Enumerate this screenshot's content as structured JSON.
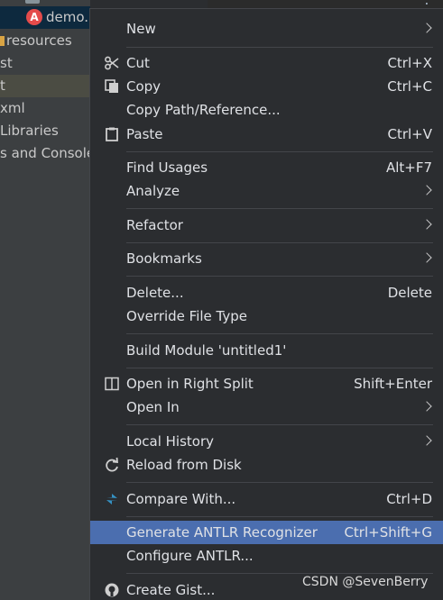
{
  "editor": {
    "fragment": "."
  },
  "tree": {
    "items": [
      {
        "label": "demo."
      },
      {
        "label": "resources"
      },
      {
        "label": "st"
      },
      {
        "label": "t"
      },
      {
        "label": "xml"
      },
      {
        "label": "Libraries"
      },
      {
        "label": "s and Console"
      }
    ]
  },
  "menu": {
    "items": [
      {
        "label": "New",
        "shortcut": ""
      },
      {
        "label": "Cut",
        "shortcut": "Ctrl+X"
      },
      {
        "label": "Copy",
        "shortcut": "Ctrl+C"
      },
      {
        "label": "Copy Path/Reference...",
        "shortcut": ""
      },
      {
        "label": "Paste",
        "shortcut": "Ctrl+V"
      },
      {
        "label": "Find Usages",
        "shortcut": "Alt+F7"
      },
      {
        "label": "Analyze",
        "shortcut": ""
      },
      {
        "label": "Refactor",
        "shortcut": ""
      },
      {
        "label": "Bookmarks",
        "shortcut": ""
      },
      {
        "label": "Delete...",
        "shortcut": "Delete"
      },
      {
        "label": "Override File Type",
        "shortcut": ""
      },
      {
        "label": "Build Module 'untitled1'",
        "shortcut": ""
      },
      {
        "label": "Open in Right Split",
        "shortcut": "Shift+Enter"
      },
      {
        "label": "Open In",
        "shortcut": ""
      },
      {
        "label": "Local History",
        "shortcut": ""
      },
      {
        "label": "Reload from Disk",
        "shortcut": ""
      },
      {
        "label": "Compare With...",
        "shortcut": "Ctrl+D"
      },
      {
        "label": "Generate ANTLR Recognizer",
        "shortcut": "Ctrl+Shift+G"
      },
      {
        "label": "Configure ANTLR...",
        "shortcut": ""
      },
      {
        "label": "Create Gist...",
        "shortcut": ""
      }
    ]
  },
  "watermark": "CSDN @SevenBerry",
  "colors": {
    "highlight": "#4b6eaf",
    "menu_bg": "#2b2d30",
    "tree_bg": "#3c3f41"
  }
}
